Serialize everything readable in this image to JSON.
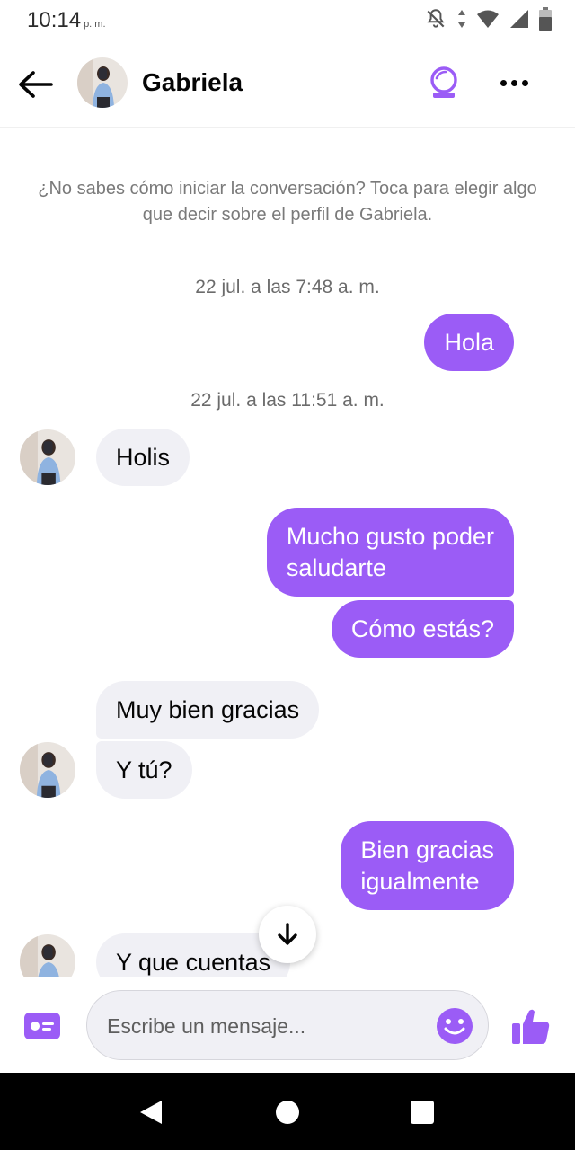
{
  "status_bar": {
    "time": "10:14",
    "ampm": "p. m."
  },
  "header": {
    "contact_name": "Gabriela"
  },
  "hint": "¿No sabes cómo iniciar la conversación? Toca para elegir algo que decir sobre el perfil de Gabriela.",
  "timestamps": [
    "22 jul. a las 7:48 a. m.",
    "22 jul. a las 11:51 a. m."
  ],
  "messages": [
    {
      "from": "me",
      "text": "Hola"
    },
    {
      "from": "them",
      "text": "Holis"
    },
    {
      "from": "me",
      "lines": [
        "Mucho gusto poder",
        "saludarte"
      ]
    },
    {
      "from": "me",
      "text": "Cómo estás?"
    },
    {
      "from": "them",
      "text": "Muy bien gracias"
    },
    {
      "from": "them",
      "text": "Y tú?"
    },
    {
      "from": "me",
      "lines": [
        "Bien gracias",
        "igualmente"
      ]
    },
    {
      "from": "them",
      "text": "Y que cuentas"
    }
  ],
  "composer": {
    "placeholder": "Escribe un mensaje..."
  },
  "colors": {
    "accent": "#9b5cf6",
    "incoming_bubble": "#f0f0f5"
  },
  "icons": [
    "back-arrow-icon",
    "story-icon",
    "more-icon",
    "arrow-down-icon",
    "contact-card-icon",
    "emoji-icon",
    "thumbs-up-icon",
    "nav-back-icon",
    "nav-home-icon",
    "nav-recents-icon"
  ]
}
